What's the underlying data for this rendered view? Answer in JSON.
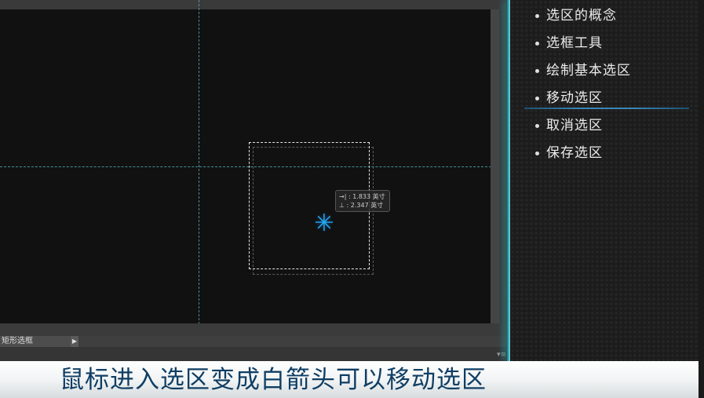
{
  "photoshop": {
    "tool_name": "矩形选框",
    "tool_arrow_icon": "play-right-icon",
    "readout": {
      "width_label": "→|",
      "width_value": "1.833",
      "height_label": "⊥",
      "height_value": "2.347",
      "unit": "英寸"
    },
    "cursor_icon": "move-cursor-icon",
    "panel_menu_icon": "panel-menu-icon"
  },
  "outline": {
    "items": [
      {
        "label": "选区的概念"
      },
      {
        "label": "选框工具"
      },
      {
        "label": "绘制基本选区"
      },
      {
        "label": "移动选区",
        "active": true
      },
      {
        "label": "取消选区"
      },
      {
        "label": "保存选区"
      }
    ]
  },
  "caption": {
    "text": "鼠标进入选区变成白箭头可以移动选区"
  },
  "colors": {
    "guide": "#4fb3b8",
    "cursor": "#28a6f0",
    "caption_text": "#0f3e64",
    "active_underline": "#3a86b6"
  }
}
